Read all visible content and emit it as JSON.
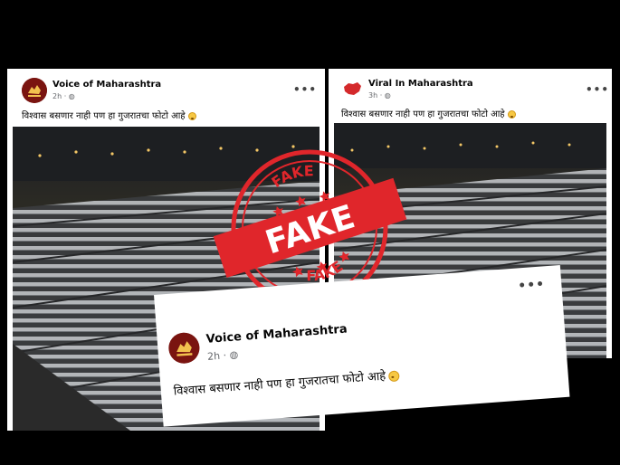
{
  "left_post": {
    "author": "Voice of Maharashtra",
    "time": "2h",
    "caption": "विश्वास बसणार नाही पण हा गुजरातचा फोटो आहे",
    "more": "•••",
    "avatar_text": "Voice of Maharashtra"
  },
  "right_post": {
    "author": "Viral In Maharashtra",
    "time": "3h",
    "caption": "विश्वास बसणार नाही पण हा गुजरातचा फोटो आहे",
    "more": "•••"
  },
  "overlay_post": {
    "author": "Voice of Maharashtra",
    "time": "2h",
    "caption": "विश्वास बसणार नाही पण हा गुजरातचा फोटो आहे",
    "more": "•••"
  },
  "stamp": {
    "label": "FAKE",
    "arc_top": "FAKE",
    "arc_bottom": "FAKE",
    "color": "#e0262b"
  },
  "colors": {
    "avatar_bg": "#7a1410",
    "page_bg": "#000000"
  }
}
